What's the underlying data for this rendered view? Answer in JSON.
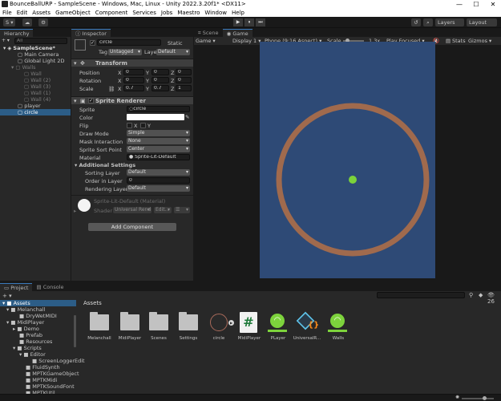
{
  "window": {
    "title": "BounceBallURP - SampleScene - Windows, Mac, Linux - Unity 2022.3.20f1* <DX11>",
    "minimize": "—",
    "maximize": "☐",
    "close": "✕"
  },
  "menu": [
    "File",
    "Edit",
    "Assets",
    "GameObject",
    "Component",
    "Services",
    "Jobs",
    "Maestro",
    "Window",
    "Help"
  ],
  "toolbar": {
    "account": "S ▾",
    "play": "▶",
    "pause": "⏸",
    "step": "⏭",
    "layers": "Layers",
    "layout": "Layout"
  },
  "hierarchy": {
    "tab": "Hierarchy",
    "add": "+ ▾",
    "search": "All",
    "items": [
      {
        "label": "SampleScene*",
        "dim": false
      },
      {
        "label": "Main Camera",
        "dim": false
      },
      {
        "label": "Global Light 2D",
        "dim": false
      },
      {
        "label": "Walls",
        "dim": true
      },
      {
        "label": "Wall",
        "dim": true
      },
      {
        "label": "Wall (2)",
        "dim": true
      },
      {
        "label": "Wall (3)",
        "dim": true
      },
      {
        "label": "Wall (1)",
        "dim": true
      },
      {
        "label": "Wall (4)",
        "dim": true
      },
      {
        "label": "player",
        "dim": false
      },
      {
        "label": "circle",
        "dim": false
      }
    ]
  },
  "inspector": {
    "tab": "Inspector",
    "name": "circle",
    "static": "Static",
    "tag_label": "Tag",
    "tag_value": "Untagged",
    "layer_label": "Layer",
    "layer_value": "Default",
    "transform": {
      "title": "Transform",
      "position_label": "Position",
      "rotation_label": "Rotation",
      "scale_label": "Scale",
      "position": {
        "x": "0",
        "y": "0",
        "z": "0"
      },
      "rotation": {
        "x": "0",
        "y": "0",
        "z": "0"
      },
      "scale": {
        "x": "0.7",
        "y": "0.7",
        "z": "1"
      }
    },
    "sprite_renderer": {
      "title": "Sprite Renderer",
      "sprite_label": "Sprite",
      "sprite_value": "circle",
      "color_label": "Color",
      "flip_label": "Flip",
      "flip_x": "X",
      "flip_y": "Y",
      "draw_mode_label": "Draw Mode",
      "draw_mode_value": "Simple",
      "mask_label": "Mask Interaction",
      "mask_value": "None",
      "sort_point_label": "Sprite Sort Point",
      "sort_point_value": "Center",
      "material_label": "Material",
      "material_value": "Sprite-Lit-Default",
      "additional": "Additional Settings",
      "sorting_layer_label": "Sorting Layer",
      "sorting_layer_value": "Default",
      "order_label": "Order in Layer",
      "order_value": "0",
      "rendering_label": "Rendering Layer M",
      "rendering_value": "Default"
    },
    "material_preview": {
      "name": "Sprite-Lit-Default (Material)",
      "shader_label": "Shader",
      "shader_value": "Universal Rend",
      "edit": "Edit...",
      "more": "☰"
    },
    "add_component": "Add Component"
  },
  "game": {
    "tab_scene": "Scene",
    "tab_game": "Game",
    "mode": "Game",
    "display": "Display 1",
    "aspect": "Phone (9:16 Aspect)",
    "scale_label": "Scale",
    "scale_value": "1.3x",
    "play_focused": "Play Focused",
    "stats": "Stats",
    "gizmos": "Gizmos",
    "colors": {
      "background": "#2e4a76",
      "ring": "#a06a4d",
      "ball": "#7bd23a"
    }
  },
  "project": {
    "tab_project": "Project",
    "tab_console": "Console",
    "add": "+ ▾",
    "hidden_count": "26",
    "breadcrumb": "Assets",
    "tree": [
      {
        "label": "Assets",
        "indent": 0
      },
      {
        "label": "Melanchall",
        "indent": 1
      },
      {
        "label": "DryWetMIDI",
        "indent": 2
      },
      {
        "label": "MidiPlayer",
        "indent": 1
      },
      {
        "label": "Demo",
        "indent": 2
      },
      {
        "label": "Prefab",
        "indent": 2
      },
      {
        "label": "Resources",
        "indent": 2
      },
      {
        "label": "Scripts",
        "indent": 2
      },
      {
        "label": "Editor",
        "indent": 3
      },
      {
        "label": "ScreenLoggerEdit",
        "indent": 4
      },
      {
        "label": "FluidSynth",
        "indent": 3
      },
      {
        "label": "MPTKGameObject",
        "indent": 3
      },
      {
        "label": "MPTKMidi",
        "indent": 3
      },
      {
        "label": "MPTKSoundFont",
        "indent": 3
      },
      {
        "label": "MPTKUtil",
        "indent": 3
      }
    ],
    "assets": [
      {
        "label": "Melanchall",
        "kind": "folder"
      },
      {
        "label": "MidiPlayer",
        "kind": "folder"
      },
      {
        "label": "Scenes",
        "kind": "folder"
      },
      {
        "label": "Settings",
        "kind": "folder"
      },
      {
        "label": "circle",
        "kind": "circle"
      },
      {
        "label": "MidiPlayer",
        "kind": "script"
      },
      {
        "label": "PLayer",
        "kind": "ball"
      },
      {
        "label": "UniversalR...",
        "kind": "settings"
      },
      {
        "label": "Walls",
        "kind": "ball"
      }
    ]
  }
}
